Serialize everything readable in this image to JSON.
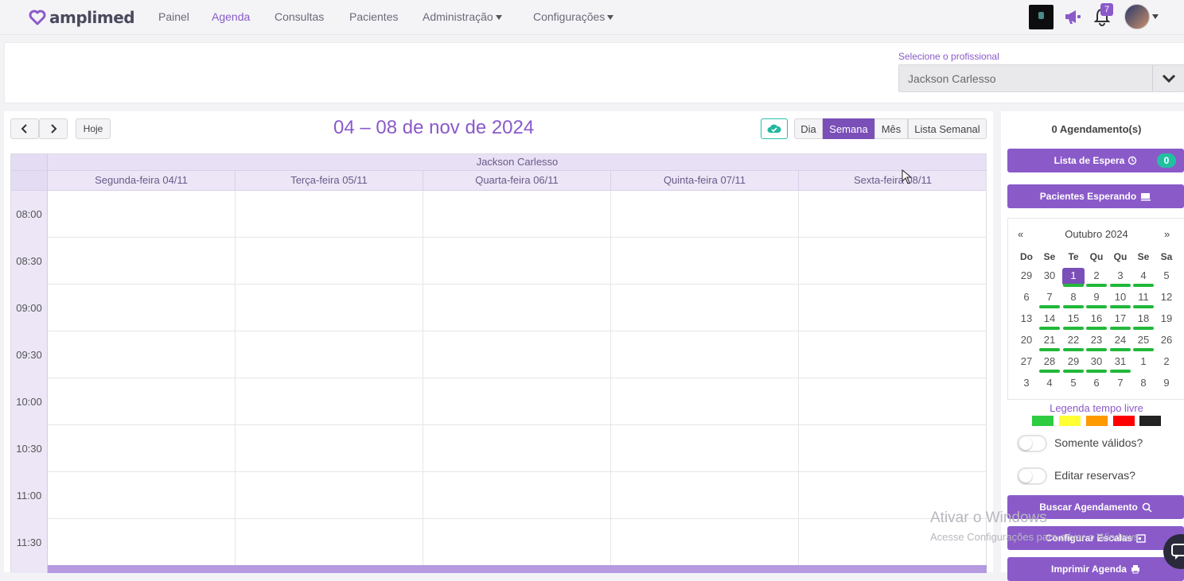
{
  "nav": {
    "brand": "amplimed",
    "items": [
      {
        "label": "Painel",
        "active": false
      },
      {
        "label": "Agenda",
        "active": true
      },
      {
        "label": "Consultas",
        "active": false
      },
      {
        "label": "Pacientes",
        "active": false
      },
      {
        "label": "Administração",
        "active": false,
        "dropdown": true
      },
      {
        "label": "Configurações",
        "active": false,
        "dropdown": true
      }
    ],
    "notifications_count": "7",
    "accent": "#8a5ac9"
  },
  "professional": {
    "label": "Selecione o profissional",
    "selected": "Jackson Carlesso"
  },
  "calendar": {
    "prev_icon": "chevron-left-icon",
    "next_icon": "chevron-right-icon",
    "today_label": "Hoje",
    "title": "04 – 08 de nov de 2024",
    "views": [
      "Dia",
      "Semana",
      "Mês",
      "Lista Semanal"
    ],
    "active_view": "Semana",
    "resource": "Jackson Carlesso",
    "days": [
      "Segunda-feira 04/11",
      "Terça-feira 05/11",
      "Quarta-feira 06/11",
      "Quinta-feira 07/11",
      "Sexta-feira 08/11"
    ],
    "times": [
      "08:00",
      "08:30",
      "09:00",
      "09:30",
      "10:00",
      "10:30",
      "11:00",
      "11:30"
    ]
  },
  "sidebar": {
    "appointments_count": "0 Agendamento(s)",
    "waiting_list_label": "Lista de Espera",
    "waiting_list_count": "0",
    "patients_waiting_label": "Pacientes Esperando",
    "mini_cal": {
      "prev": "«",
      "next": "»",
      "title": "Outubro 2024",
      "weekdays": [
        "Do",
        "Se",
        "Te",
        "Qu",
        "Qu",
        "Se",
        "Sa"
      ],
      "weeks": [
        [
          "29",
          "30",
          "1",
          "2",
          "3",
          "4",
          "5"
        ],
        [
          "6",
          "7",
          "8",
          "9",
          "10",
          "11",
          "12"
        ],
        [
          "13",
          "14",
          "15",
          "16",
          "17",
          "18",
          "19"
        ],
        [
          "20",
          "21",
          "22",
          "23",
          "24",
          "25",
          "26"
        ],
        [
          "27",
          "28",
          "29",
          "30",
          "31",
          "1",
          "2"
        ],
        [
          "3",
          "4",
          "5",
          "6",
          "7",
          "8",
          "9"
        ]
      ],
      "selected_day": "1"
    },
    "legend_title": "Legenda tempo livre",
    "legend_colors": [
      "#2ecc40",
      "#ffff33",
      "#ff9900",
      "#ff0000",
      "#222222"
    ],
    "toggle_valid": "Somente válidos?",
    "toggle_edit": "Editar reservas?",
    "search_label": "Buscar Agendamento",
    "config_label": "Configurar Escalas",
    "print_label": "Imprimir Agenda"
  },
  "watermark": {
    "title": "Ativar o Windows",
    "subtitle": "Acesse Configurações para ativar o Windows."
  }
}
